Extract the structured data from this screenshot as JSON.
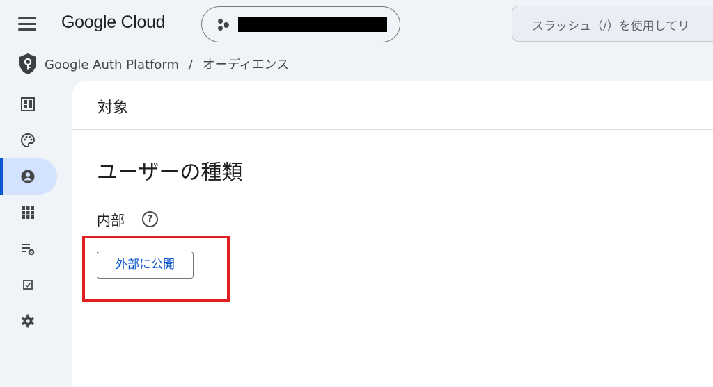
{
  "header": {
    "logo": "Google Cloud",
    "search_placeholder": "スラッシュ（/）を使用してリ"
  },
  "breadcrumb": {
    "items": [
      "Google Auth Platform",
      "/",
      "オーディエンス"
    ]
  },
  "sidebar": {
    "items": [
      {
        "icon": "dashboard-icon"
      },
      {
        "icon": "branding-icon"
      },
      {
        "icon": "audience-icon",
        "active": true
      },
      {
        "icon": "clients-icon"
      },
      {
        "icon": "data-access-icon"
      },
      {
        "icon": "verification-center-icon"
      },
      {
        "icon": "settings-icon"
      }
    ]
  },
  "main": {
    "header_title": "対象",
    "section_title": "ユーザーの種類",
    "user_type": "内部",
    "help_glyph": "?",
    "publish_button": "外部に公開"
  },
  "colors": {
    "accent": "#0b57d0",
    "highlight": "#e02020",
    "background": "#f0f4f9"
  }
}
